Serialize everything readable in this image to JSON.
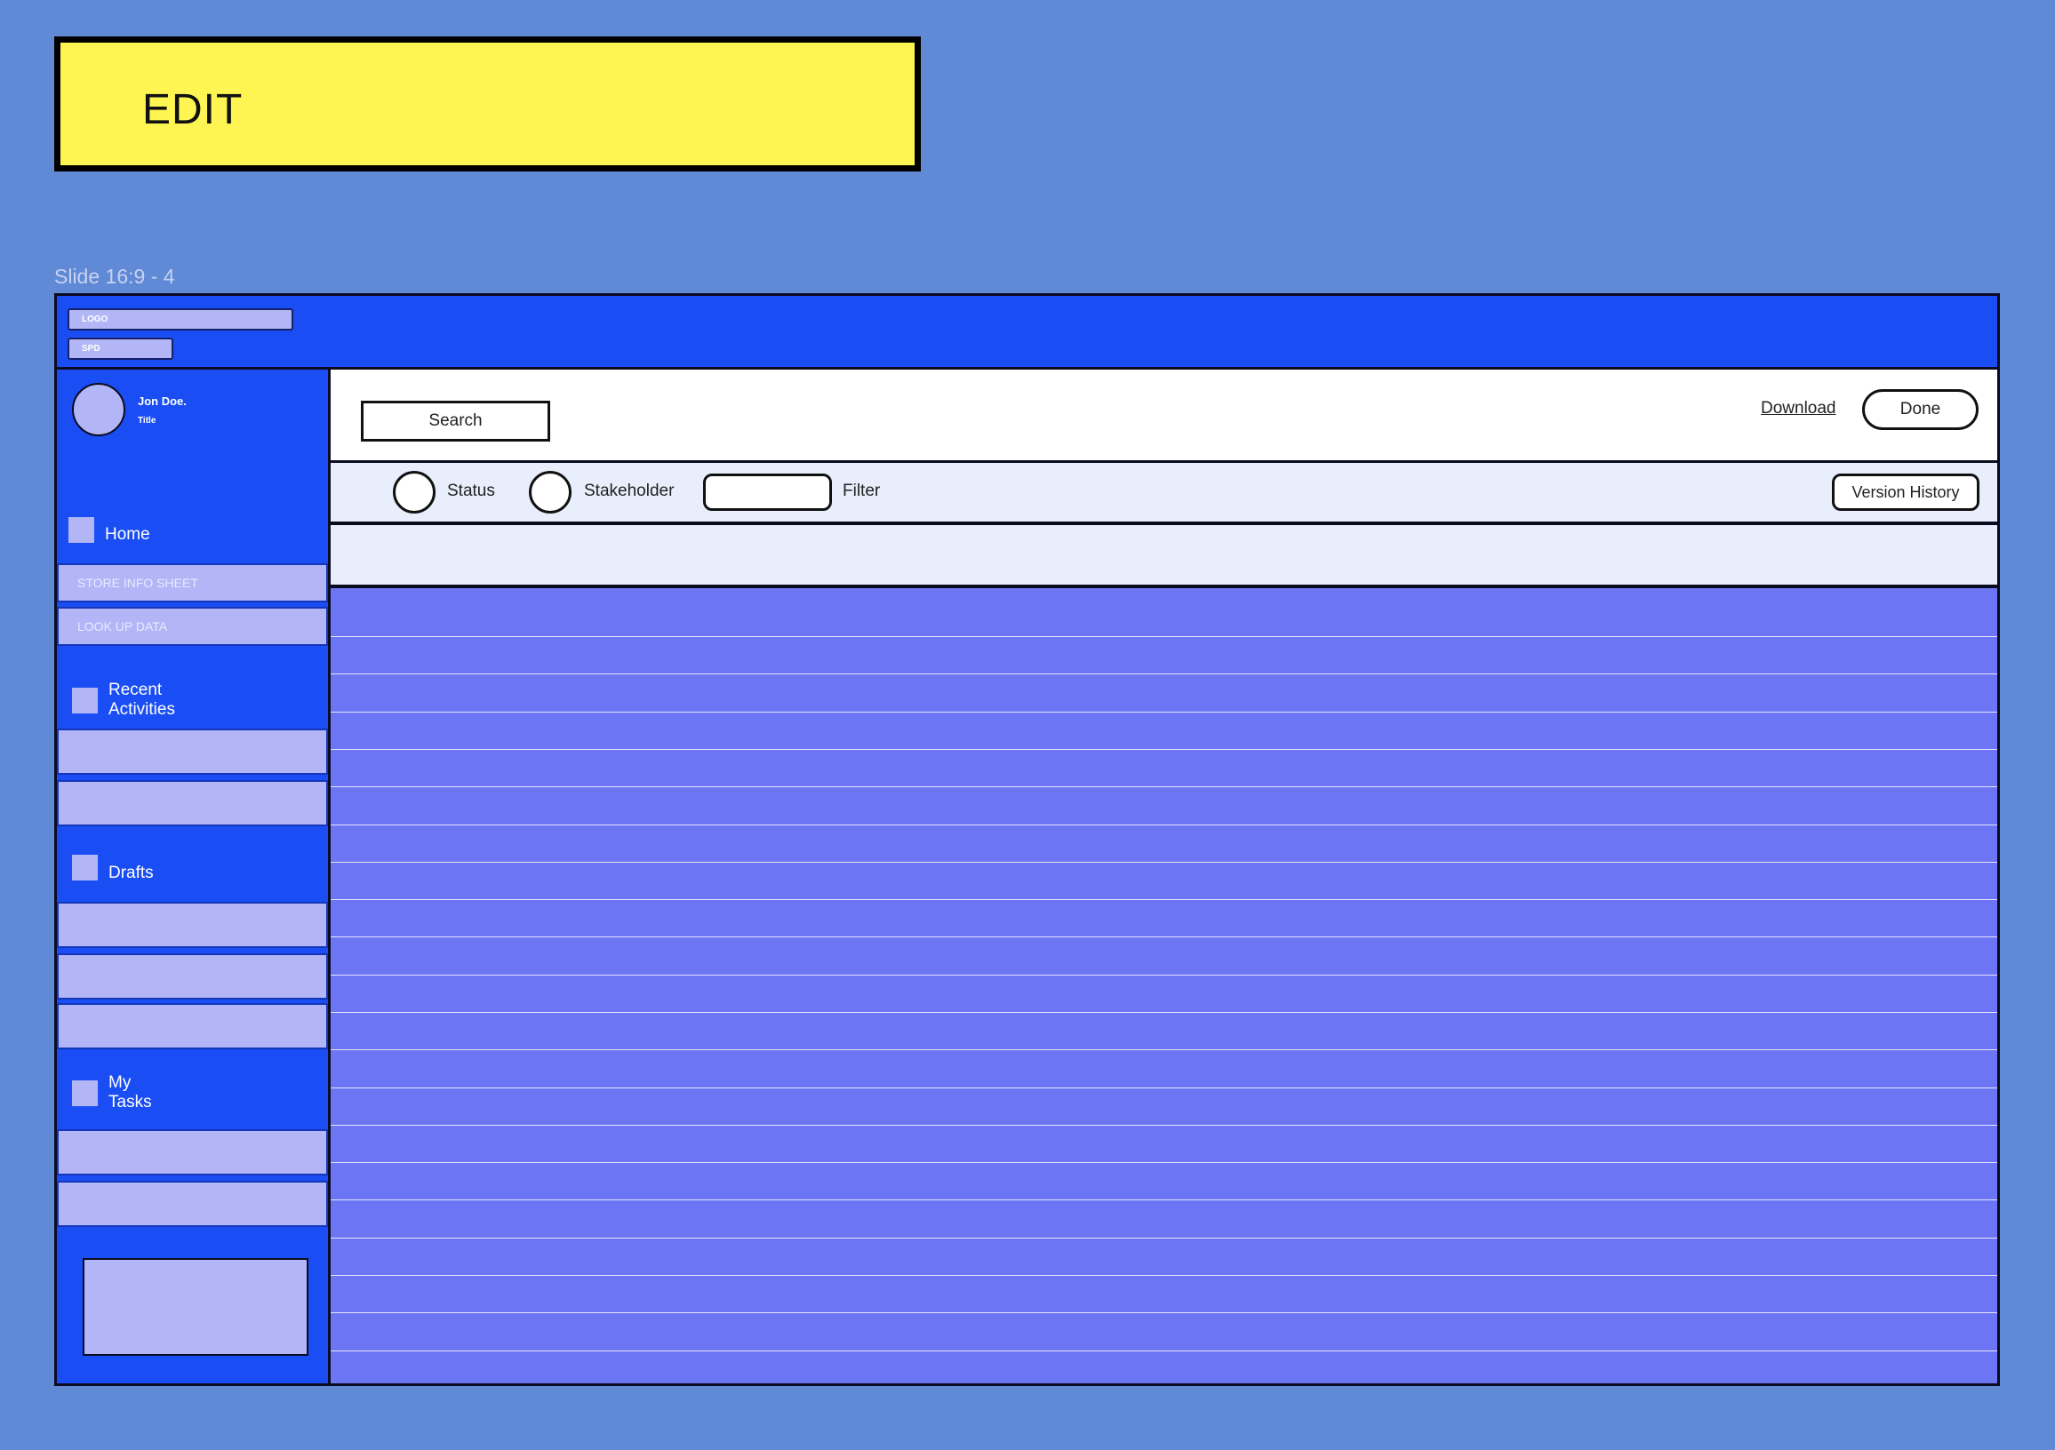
{
  "banner": {
    "label": "EDIT",
    "color": "#fef552"
  },
  "frame": {
    "label": "Slide 16:9 - 4"
  },
  "header": {
    "logo_label": "LOGO",
    "spd_label": "SPD"
  },
  "user": {
    "name": "Jon Doe.",
    "title": "Title"
  },
  "sidebar": {
    "home": {
      "label": "Home"
    },
    "home_items": [
      "STORE INFO SHEET",
      "LOOK UP DATA"
    ],
    "recent": {
      "label": "Recent\nActivities",
      "line1": "Recent",
      "line2": "Activities"
    },
    "drafts": {
      "label": "Drafts"
    },
    "tasks": {
      "line1": "My",
      "line2": "Tasks"
    }
  },
  "toolbar": {
    "search_label": "Search",
    "download_label": "Download",
    "done_label": "Done"
  },
  "filters": {
    "status_label": "Status",
    "stakeholder_label": "Stakeholder",
    "filter_label": "Filter",
    "version_history_label": "Version History"
  },
  "colors": {
    "background": "#6089d6",
    "primary": "#1a4ef4",
    "light": "#b2b6f7",
    "grid": "#6c75f3",
    "filterbar": "#e8eefb"
  }
}
